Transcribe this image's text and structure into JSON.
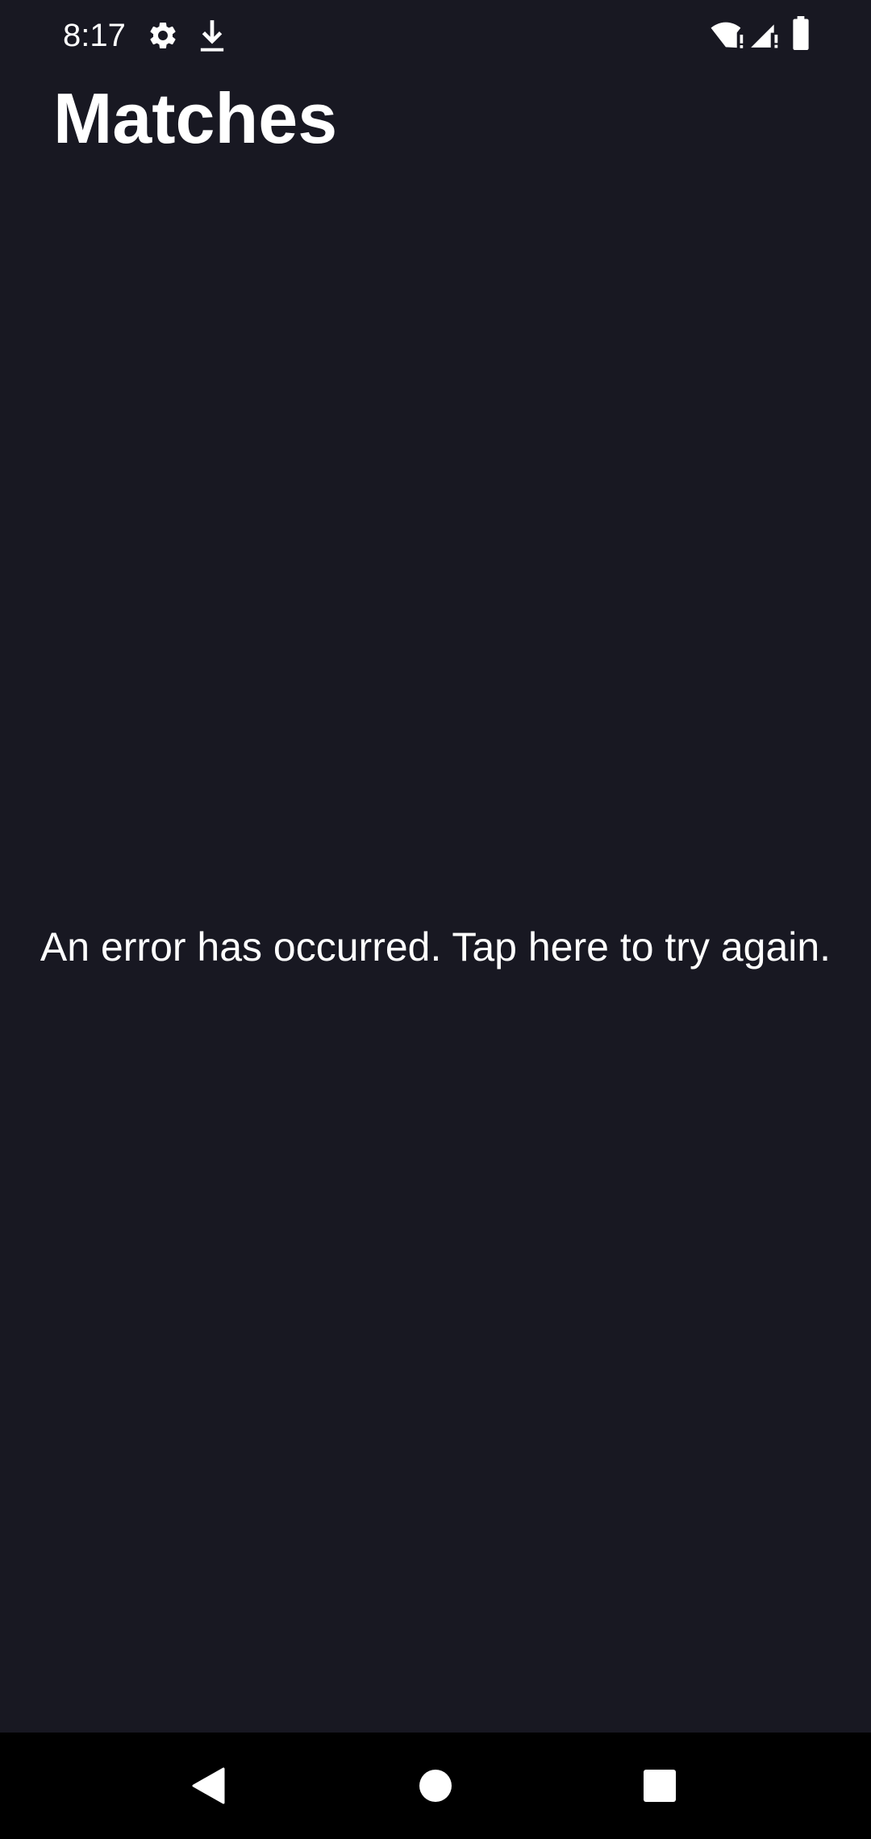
{
  "status_bar": {
    "time": "8:17",
    "icons": [
      "settings-icon",
      "download-icon",
      "wifi-alert-icon",
      "signal-alert-icon",
      "battery-icon"
    ]
  },
  "page": {
    "title": "Matches"
  },
  "error": {
    "message": "An error has occurred. Tap here to try again."
  },
  "nav_bar": {
    "buttons": [
      "back-icon",
      "home-icon",
      "recents-icon"
    ]
  },
  "colors": {
    "background": "#181822",
    "text": "#ffffff",
    "nav_background": "#000000"
  }
}
